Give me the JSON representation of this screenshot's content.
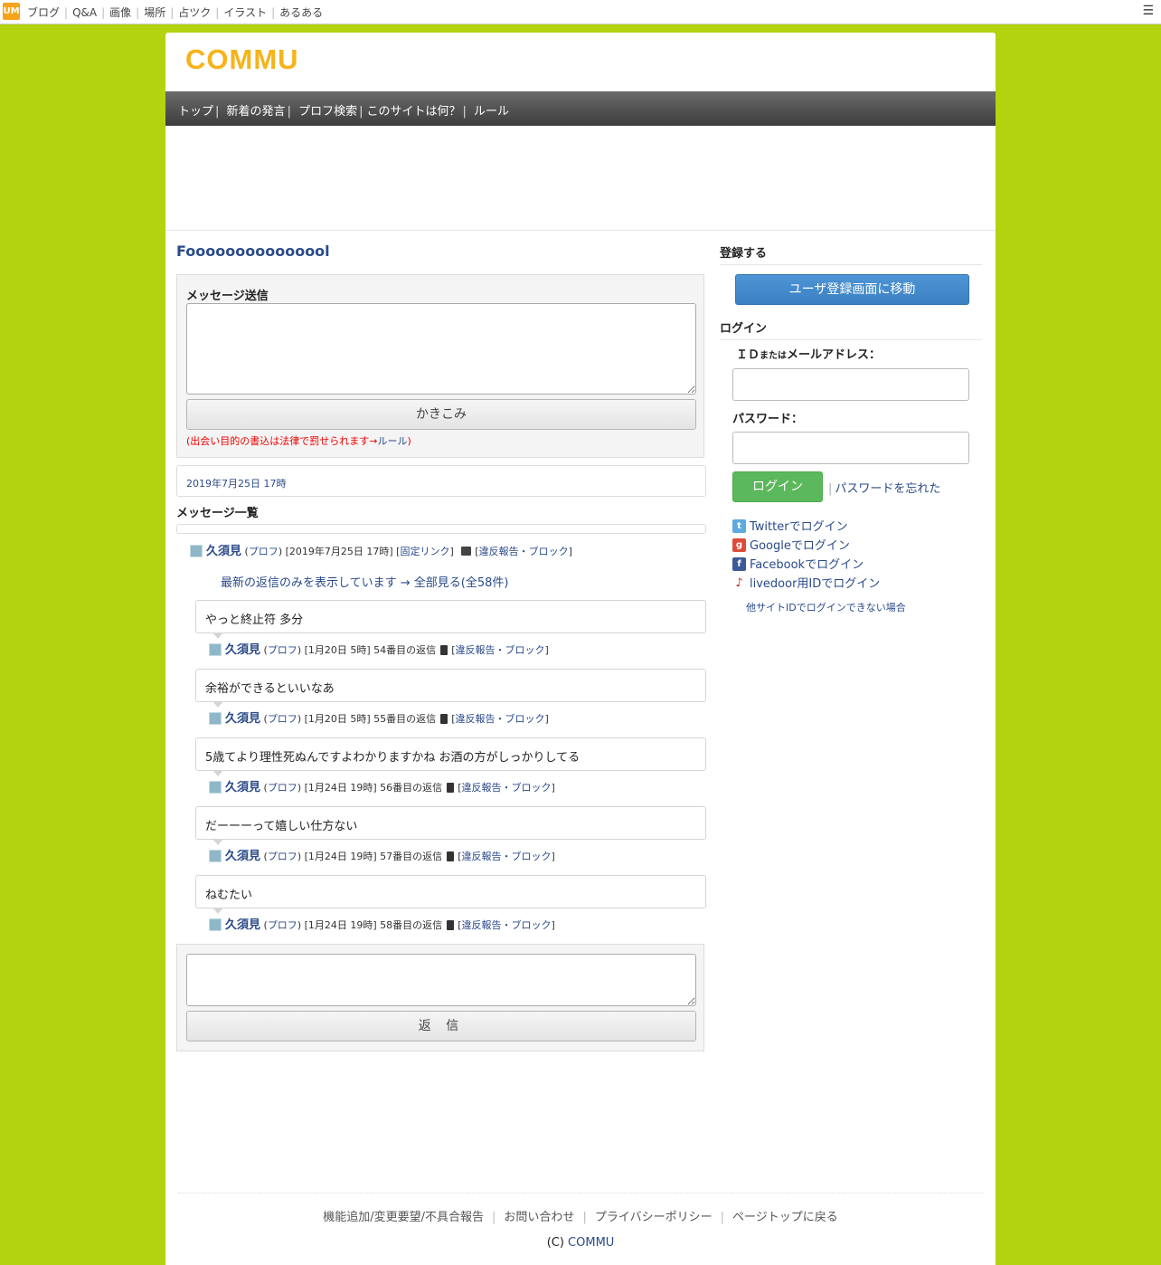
{
  "topbar": {
    "logo": "UM",
    "links": [
      "ブログ",
      "Q&A",
      "画像",
      "場所",
      "占ツク",
      "イラスト",
      "あるある"
    ],
    "menu_icon": "hamburger-icon"
  },
  "brand": "COMMU",
  "nav": [
    "トップ",
    "新着の発言",
    "プロフ検索",
    "このサイトは何？",
    "ルール"
  ],
  "page_title": "Fooooooooooooool",
  "message_form": {
    "label": "メッセージ送信",
    "submit": "かきこみ",
    "warning_text": "(出会い目的の書込は法律で罰せられます→",
    "warning_link": "ルール",
    "warning_close": ")"
  },
  "thread_date": "2019年7月25日 17時",
  "list_title": "メッセージ一覧",
  "main_post": {
    "user": "久須見",
    "prof": "プロフ",
    "datetime": "[2019年7月25日 17時]",
    "permalink": "固定リンク",
    "report": "違反報告・ブロック"
  },
  "latest_note": "最新の返信のみを表示しています → 全部見る(全58件)",
  "replies": [
    {
      "text": "やっと終止符 多分",
      "user": "久須見",
      "prof": "プロフ",
      "meta": "[1月20日 5時] 54番目の返信",
      "report": "違反報告・ブロック"
    },
    {
      "text": "余裕ができるといいなあ",
      "user": "久須見",
      "prof": "プロフ",
      "meta": "[1月20日 5時] 55番目の返信",
      "report": "違反報告・ブロック"
    },
    {
      "text": "5歳てより理性死ぬんですよわかりますかね お酒の方がしっかりしてる",
      "user": "久須見",
      "prof": "プロフ",
      "meta": "[1月24日 19時] 56番目の返信",
      "report": "違反報告・ブロック"
    },
    {
      "text": "だーーーって嬉しい仕方ない",
      "user": "久須見",
      "prof": "プロフ",
      "meta": "[1月24日 19時] 57番目の返信",
      "report": "違反報告・ブロック"
    },
    {
      "text": "ねむたい",
      "user": "久須見",
      "prof": "プロフ",
      "meta": "[1月24日 19時] 58番目の返信",
      "report": "違反報告・ブロック"
    }
  ],
  "reply_form": {
    "submit": "返 信"
  },
  "sidebar": {
    "register_heading": "登録する",
    "register_button": "ユーザ登録画面に移動",
    "login_heading": "ログイン",
    "id_label_1": "ＩＤ",
    "id_label_small": "または",
    "id_label_2": "メールアドレス：",
    "password_label": "パスワード：",
    "login_button": "ログイン",
    "forgot": "パスワードを忘れた",
    "social": [
      {
        "label": "Twitterでログイン",
        "icon": "twitter-icon",
        "color": "#5ea9dd"
      },
      {
        "label": "Googleでログイン",
        "icon": "google-icon",
        "color": "#dd4b39"
      },
      {
        "label": "Facebookでログイン",
        "icon": "facebook-icon",
        "color": "#3b5998"
      },
      {
        "label": "livedoor用IDでログイン",
        "icon": "livedoor-icon",
        "color": "#d2232a"
      }
    ],
    "other_login": "他サイトIDでログインできない場合"
  },
  "footer": {
    "links": [
      "機能追加/変更要望/不具合報告",
      "お問い合わせ",
      "プライバシーポリシー",
      "ページトップに戻る"
    ],
    "copyright_prefix": "(C) ",
    "copyright_link": "COMMU"
  },
  "colors": {
    "background": "#b3d30e",
    "brand": "#f7b31a",
    "link": "#2a4a8a",
    "login_green": "#5cb85c",
    "register_blue": "#428bca"
  }
}
